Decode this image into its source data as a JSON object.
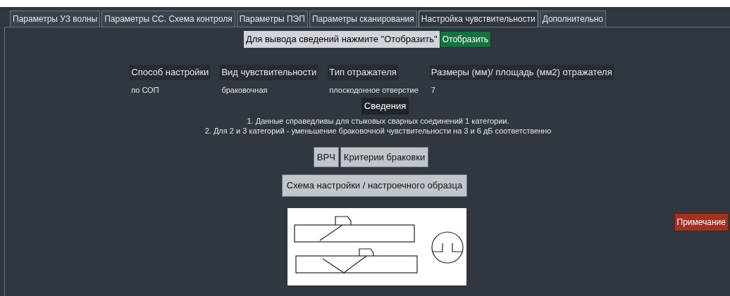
{
  "tabs": [
    {
      "label": "Параметры УЗ волны",
      "selected": false
    },
    {
      "label": "Параметры СС. Схема контроля",
      "selected": false
    },
    {
      "label": "Параметры ПЭП",
      "selected": false
    },
    {
      "label": "Параметры сканирования",
      "selected": false
    },
    {
      "label": "Настройка чувствительности",
      "selected": true
    },
    {
      "label": "Дополнительно",
      "selected": false
    }
  ],
  "prompt": {
    "text": "Для вывода сведений нажмите \"Отобразить\"",
    "button": "Отобразить"
  },
  "columns": [
    {
      "header": "Способ настройки",
      "value": "по СОП"
    },
    {
      "header": "Вид чувствительности",
      "value": "браковочная"
    },
    {
      "header": "Тип отражателя",
      "value": "плоскодонное отверстие"
    },
    {
      "header": "Размеры (мм)/ площадь (мм2) отражателя",
      "value": "7"
    }
  ],
  "info": {
    "title": "Сведения",
    "notes": [
      "1. Данные справедливы для стыковых сварных соединений 1 категории.",
      "2. Для 2 и 3 категорий - уменьшение браковочной чувствительности на 3 и 6 дБ соответственно"
    ]
  },
  "buttons": [
    "ВРЧ",
    "Критерии браковки"
  ],
  "scheme_button": "Схема настройки / настроечного образца",
  "note_button": "Примечание"
}
